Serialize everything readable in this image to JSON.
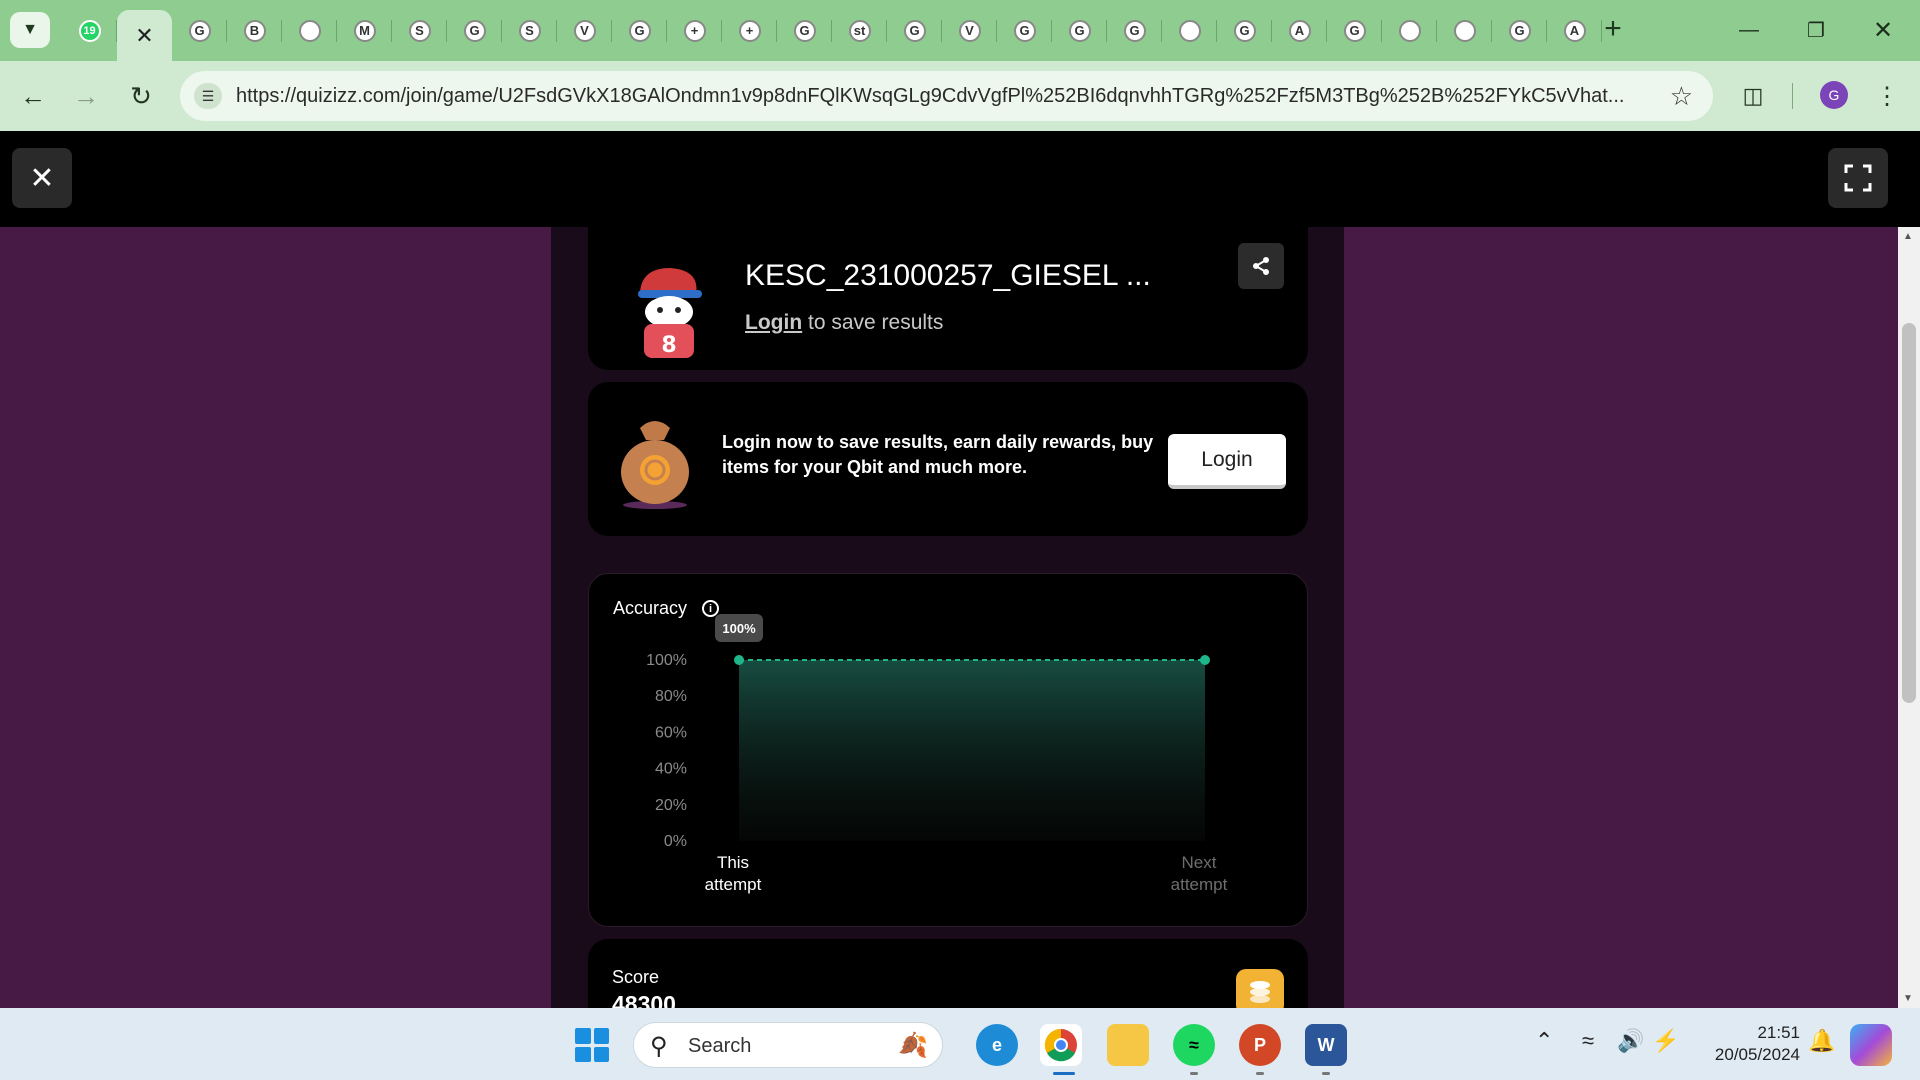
{
  "browser": {
    "url": "https://quizizz.com/join/game/U2FsdGVkX18GAlOndmn1v9p8dnFQlKWsqGLg9CdvVgfPl%252BI6dqnvhhTGRg%252Fzf5M3TBg%252B%252FYkC5vVhat...",
    "whatsapp_badge": "19",
    "profile_initial": "G",
    "tab_glyphs": [
      "G",
      "B",
      "",
      "M",
      "S",
      "G",
      "S",
      "V",
      "G",
      "+",
      "+",
      "G",
      "st",
      "G",
      "V",
      "G",
      "G",
      "G",
      "",
      "G",
      "A",
      "G",
      "",
      "",
      "G",
      "A"
    ]
  },
  "profile": {
    "name": "KESC_231000257_GIESEL ...",
    "login_link": "Login",
    "login_suffix": "to save results"
  },
  "promo": {
    "text": "Login now to save results, earn daily rewards, buy items for your Qbit and much more.",
    "button": "Login"
  },
  "accuracy": {
    "title": "Accuracy",
    "info": "i"
  },
  "chart_data": {
    "type": "area",
    "title": "Accuracy",
    "categories": [
      "This attempt",
      "Next attempt"
    ],
    "values": [
      100,
      100
    ],
    "y_ticks": [
      "100%",
      "80%",
      "60%",
      "40%",
      "20%",
      "0%"
    ],
    "ylim": [
      0,
      100
    ],
    "tooltip": "100%",
    "color": "#1fb58a"
  },
  "score": {
    "title": "Score",
    "value": "48300"
  },
  "taskbar": {
    "search_label": "Search",
    "time": "21:51",
    "date": "20/05/2024",
    "word_letter": "W",
    "ppt_letter": "P"
  },
  "colors": {
    "page_bg": "#461a45",
    "tabstrip": "#8fcc8f",
    "accent_green": "#1fb58a"
  }
}
